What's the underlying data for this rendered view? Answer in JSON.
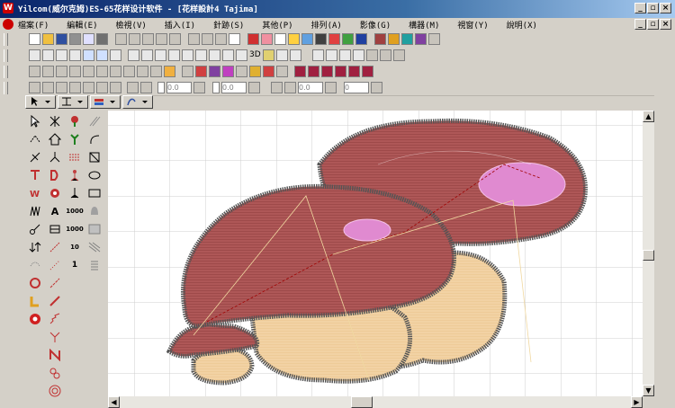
{
  "window": {
    "title": "Yilcom(威尔克姆)ES-65花样设计软件 - [花样設計4          Tajima]",
    "app_icon": "W",
    "buttons": [
      "_",
      "▫",
      "×"
    ]
  },
  "menu": {
    "items": [
      "檔案(F)",
      "編輯(E)",
      "檢視(V)",
      "插入(I)",
      "針跡(S)",
      "其他(P)",
      "排列(A)",
      "影像(G)",
      "構器(M)",
      "視窗(Y)",
      "說明(X)"
    ],
    "doc_buttons": [
      "_",
      "▫",
      "×"
    ]
  },
  "toolbar3": {
    "label3d": "3D"
  },
  "toolbar5": {
    "field1": "0.0",
    "field2": "0.0",
    "field3": "0.0",
    "field4": "0"
  },
  "palette": {
    "text_tool": "A",
    "num_1000a": "1000",
    "num_1000b": "1000",
    "num_10": "10",
    "num_1": "1"
  },
  "colors": {
    "fabric_red": "#9e4a4a",
    "fabric_pink": "#e08ad0",
    "fabric_tan": "#eecb98",
    "outline": "#555555",
    "grid": "#cfcfcf"
  }
}
